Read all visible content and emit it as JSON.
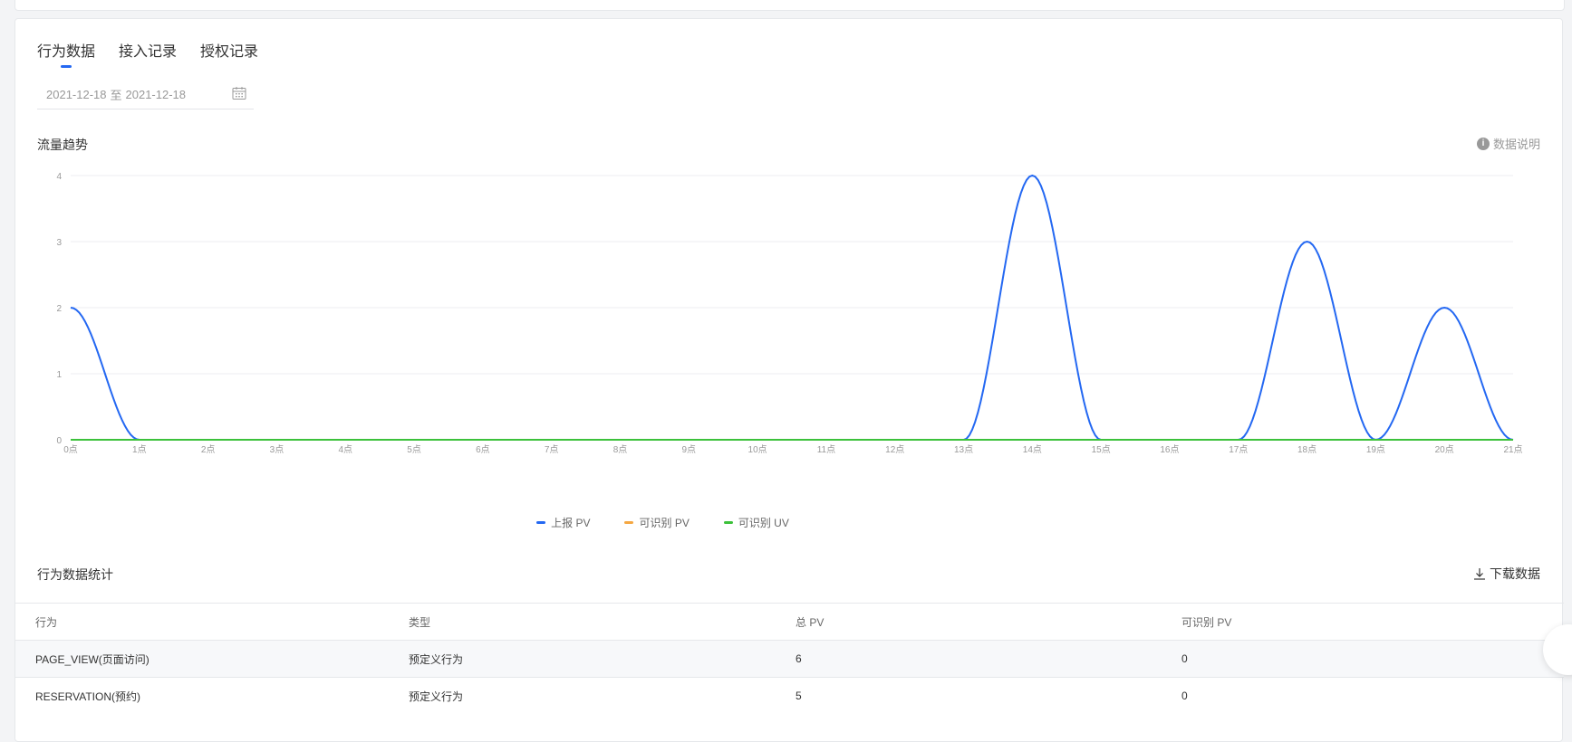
{
  "tabs": [
    {
      "label": "行为数据",
      "active": true
    },
    {
      "label": "接入记录",
      "active": false
    },
    {
      "label": "授权记录",
      "active": false
    }
  ],
  "date_range": {
    "start": "2021-12-18",
    "separator": "至",
    "end": "2021-12-18"
  },
  "trend": {
    "title": "流量趋势",
    "info_label": "数据说明"
  },
  "chart_data": {
    "type": "line",
    "x": [
      "0点",
      "1点",
      "2点",
      "3点",
      "4点",
      "5点",
      "6点",
      "7点",
      "8点",
      "9点",
      "10点",
      "11点",
      "12点",
      "13点",
      "14点",
      "15点",
      "16点",
      "17点",
      "18点",
      "19点",
      "20点",
      "21点"
    ],
    "ylim": [
      0,
      4
    ],
    "yticks": [
      0,
      1,
      2,
      3,
      4
    ],
    "grid": true,
    "legend_position": "bottom",
    "series": [
      {
        "name": "上报 PV",
        "color": "#2468f2",
        "values": [
          2,
          0,
          0,
          0,
          0,
          0,
          0,
          0,
          0,
          0,
          0,
          0,
          0,
          0,
          4,
          0,
          0,
          0,
          3,
          0,
          2,
          0
        ]
      },
      {
        "name": "可识别 PV",
        "color": "#f5a742",
        "values": [
          0,
          0,
          0,
          0,
          0,
          0,
          0,
          0,
          0,
          0,
          0,
          0,
          0,
          0,
          0,
          0,
          0,
          0,
          0,
          0,
          0,
          0
        ]
      },
      {
        "name": "可识别 UV",
        "color": "#3cc13b",
        "values": [
          0,
          0,
          0,
          0,
          0,
          0,
          0,
          0,
          0,
          0,
          0,
          0,
          0,
          0,
          0,
          0,
          0,
          0,
          0,
          0,
          0,
          0
        ]
      }
    ]
  },
  "stats": {
    "title": "行为数据统计",
    "download_label": "下载数据",
    "columns": [
      "行为",
      "类型",
      "总 PV",
      "可识别 PV"
    ],
    "rows": [
      [
        "PAGE_VIEW(页面访问)",
        "预定义行为",
        "6",
        "0"
      ],
      [
        "RESERVATION(预约)",
        "预定义行为",
        "5",
        "0"
      ]
    ]
  }
}
